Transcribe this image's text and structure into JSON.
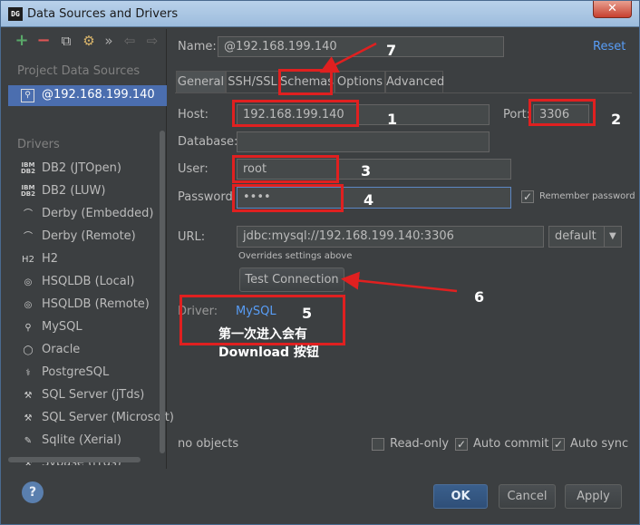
{
  "window": {
    "title": "Data Sources and Drivers",
    "icon": "DG",
    "close": "✕"
  },
  "toolbar": {
    "add": "+",
    "remove": "−",
    "copy": "⧉",
    "settings": "⚙",
    "more": "»",
    "back": "⇦",
    "forward": "⇨"
  },
  "sidebar": {
    "project_header": "Project Data Sources",
    "project_item": "@192.168.199.140",
    "drivers_header": "Drivers",
    "drivers": [
      {
        "icon": "IBM DB2",
        "label": "DB2 (JTOpen)"
      },
      {
        "icon": "IBM DB2",
        "label": "DB2 (LUW)"
      },
      {
        "icon": "⌒",
        "label": "Derby (Embedded)"
      },
      {
        "icon": "⌒",
        "label": "Derby (Remote)"
      },
      {
        "icon": "H2",
        "label": "H2"
      },
      {
        "icon": "◎",
        "label": "HSQLDB (Local)"
      },
      {
        "icon": "◎",
        "label": "HSQLDB (Remote)"
      },
      {
        "icon": "⚲",
        "label": "MySQL"
      },
      {
        "icon": "◯",
        "label": "Oracle"
      },
      {
        "icon": "⚕",
        "label": "PostgreSQL"
      },
      {
        "icon": "⚒",
        "label": "SQL Server (jTds)"
      },
      {
        "icon": "⚒",
        "label": "SQL Server (Microsoft)"
      },
      {
        "icon": "✎",
        "label": "Sqlite (Xerial)"
      },
      {
        "icon": "⚒",
        "label": "Sybase (jTds)"
      }
    ]
  },
  "form": {
    "name_label": "Name:",
    "name_value": "@192.168.199.140",
    "reset": "Reset",
    "tabs": [
      "General",
      "SSH/SSL",
      "Schemas",
      "Options",
      "Advanced"
    ],
    "host_label": "Host:",
    "host_value": "192.168.199.140",
    "port_label": "Port:",
    "port_value": "3306",
    "database_label": "Database:",
    "database_value": "",
    "user_label": "User:",
    "user_value": "root",
    "password_label": "Password",
    "password_value": "••••",
    "remember_label": "Remember password",
    "url_label": "URL:",
    "url_value": "jdbc:mysql://192.168.199.140:3306",
    "url_mode": "default",
    "url_hint": "Overrides settings above",
    "test_button": "Test Connection",
    "driver_label": "Driver:",
    "driver_value": "MySQL",
    "status": "no objects",
    "readonly_label": "Read-only",
    "autocommit_label": "Auto commit",
    "autosync_label": "Auto sync"
  },
  "buttons": {
    "help": "?",
    "ok": "OK",
    "cancel": "Cancel",
    "apply": "Apply"
  },
  "annotations": {
    "n1": "1",
    "n2": "2",
    "n3": "3",
    "n4": "4",
    "n5": "5",
    "n6": "6",
    "n7": "7",
    "note_line1": "第一次进入会有",
    "note_line2": "Download 按钮"
  },
  "colors": {
    "annotation": "#e02020",
    "link": "#589df6",
    "selection": "#4b6eaf",
    "background": "#3c3f41"
  }
}
